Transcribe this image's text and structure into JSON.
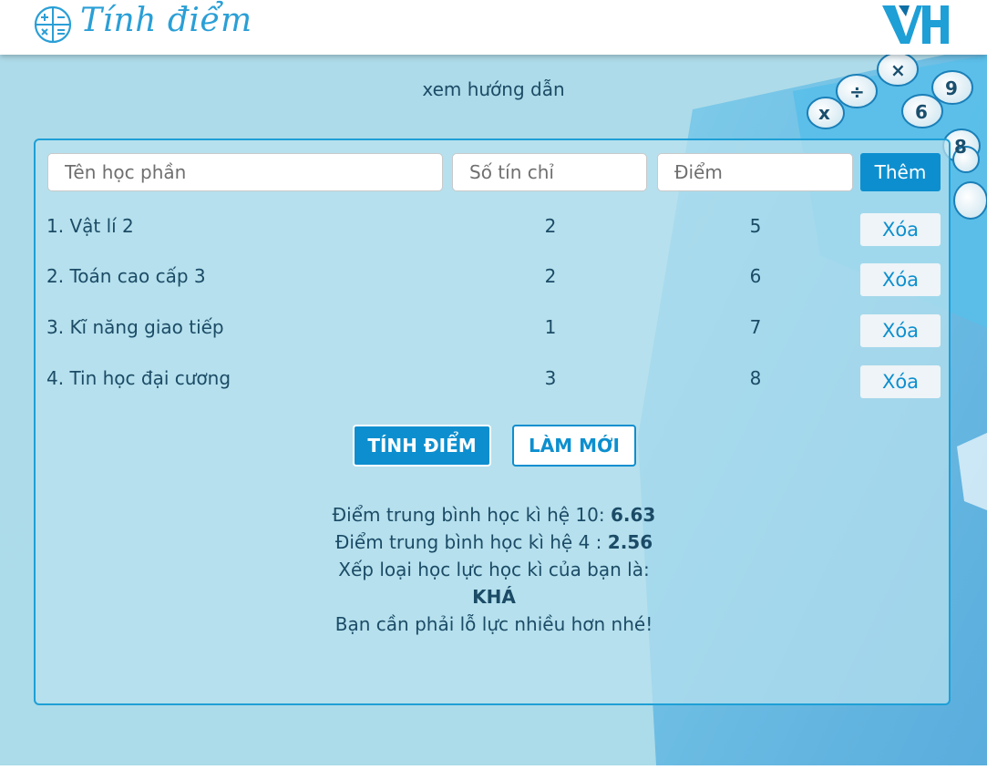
{
  "header": {
    "title": "Tính điểm",
    "brand_icon": "calculator-icon",
    "logo": "vh-logo",
    "accent_color": "#2a9fd6"
  },
  "guide_link": "xem hướng dẫn",
  "form": {
    "course_placeholder": "Tên học phần",
    "credits_placeholder": "Số tín chỉ",
    "grade_placeholder": "Điểm",
    "add_label": "Thêm"
  },
  "courses": [
    {
      "name": "1. Vật lí 2",
      "credits": "2",
      "grade": "5",
      "delete_label": "Xóa"
    },
    {
      "name": "2. Toán cao cấp 3",
      "credits": "2",
      "grade": "6",
      "delete_label": "Xóa"
    },
    {
      "name": "3. Kĩ năng giao tiếp",
      "credits": "1",
      "grade": "7",
      "delete_label": "Xóa"
    },
    {
      "name": "4. Tin học đại cương",
      "credits": "3",
      "grade": "8",
      "delete_label": "Xóa"
    }
  ],
  "actions": {
    "calculate_label": "TÍNH ĐIỂM",
    "reset_label": "LÀM MỚI"
  },
  "result": {
    "gpa10_label": "Điểm trung bình học kì hệ 10:",
    "gpa10_value": "6.63",
    "gpa4_label": "Điểm trung bình học kì hệ 4 :",
    "gpa4_value": "2.56",
    "rank_label": "Xếp loại học lực học kì của bạn là:",
    "rank_value": "KHÁ",
    "message": "Bạn cần phải lỗ lực nhiều hơn nhé!"
  },
  "colors": {
    "primary": "#0d8fcf",
    "text": "#1b4b66",
    "background": "#aedbe9"
  }
}
